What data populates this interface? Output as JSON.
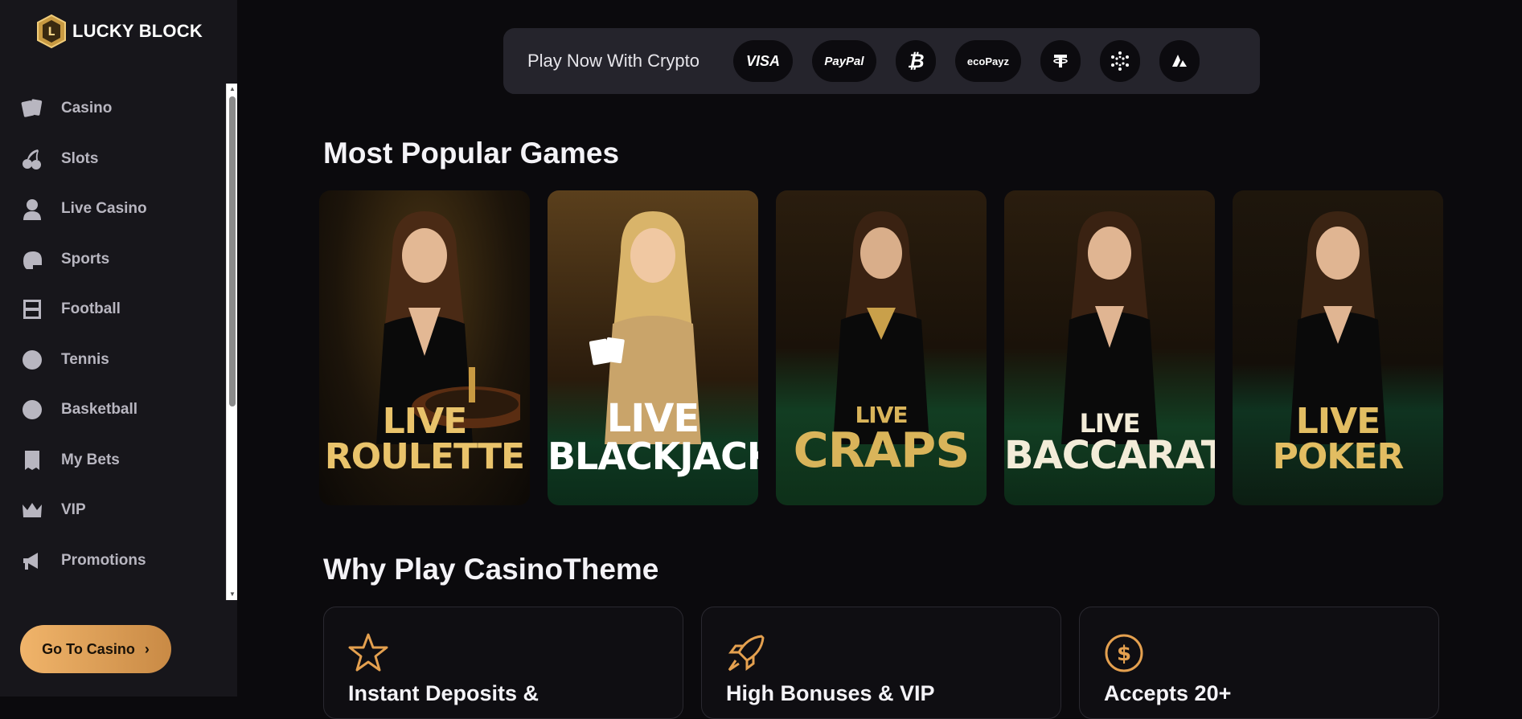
{
  "brand": {
    "name": "LUCKY BLOCK"
  },
  "sidebar": {
    "items": [
      {
        "label": "Casino",
        "icon": "cards-icon"
      },
      {
        "label": "Slots",
        "icon": "cherries-icon"
      },
      {
        "label": "Live Casino",
        "icon": "dealer-icon"
      },
      {
        "label": "Sports",
        "icon": "sports-helmet-icon"
      },
      {
        "label": "Football",
        "icon": "football-pitch-icon"
      },
      {
        "label": "Tennis",
        "icon": "tennis-ball-icon"
      },
      {
        "label": "Basketball",
        "icon": "basketball-icon"
      },
      {
        "label": "My Bets",
        "icon": "receipt-icon"
      },
      {
        "label": "VIP",
        "icon": "crown-icon"
      },
      {
        "label": "Promotions",
        "icon": "megaphone-icon"
      }
    ],
    "cta_label": "Go To Casino"
  },
  "payments": {
    "label": "Play Now With Crypto",
    "methods": [
      {
        "label": "VISA",
        "icon": "visa-logo"
      },
      {
        "label": "PayPal",
        "icon": "paypal-logo"
      },
      {
        "label": "",
        "icon": "bitcoin-icon"
      },
      {
        "label": "ecoPayz",
        "icon": "ecopayz-logo"
      },
      {
        "label": "",
        "icon": "tether-icon"
      },
      {
        "label": "",
        "icon": "cardano-icon"
      },
      {
        "label": "",
        "icon": "avalanche-icon"
      }
    ]
  },
  "popular": {
    "title": "Most Popular Games",
    "games": [
      {
        "line1": "LIVE",
        "line2": "ROULETTE",
        "color": "#e9c36b"
      },
      {
        "line1": "LIVE",
        "line2": "BLACKJACK",
        "color": "#ffffff"
      },
      {
        "line1": "LIVE",
        "line2": "CRAPS",
        "color": "#d9b45a"
      },
      {
        "line1": "LIVE",
        "line2": "BACCARAT",
        "color": "#f3ecd8"
      },
      {
        "line1": "",
        "line2": "LIVE POKER",
        "color": "#e2bd62"
      }
    ]
  },
  "why": {
    "title": "Why Play CasinoTheme",
    "features": [
      {
        "title": "Instant Deposits &",
        "icon": "star-icon"
      },
      {
        "title": "High Bonuses & VIP",
        "icon": "rocket-icon"
      },
      {
        "title": "Accepts 20+",
        "icon": "dollar-coin-icon"
      }
    ]
  },
  "colors": {
    "accent": "#e4a04f",
    "sidebar": "#17161b",
    "background": "#0b0a0d"
  }
}
